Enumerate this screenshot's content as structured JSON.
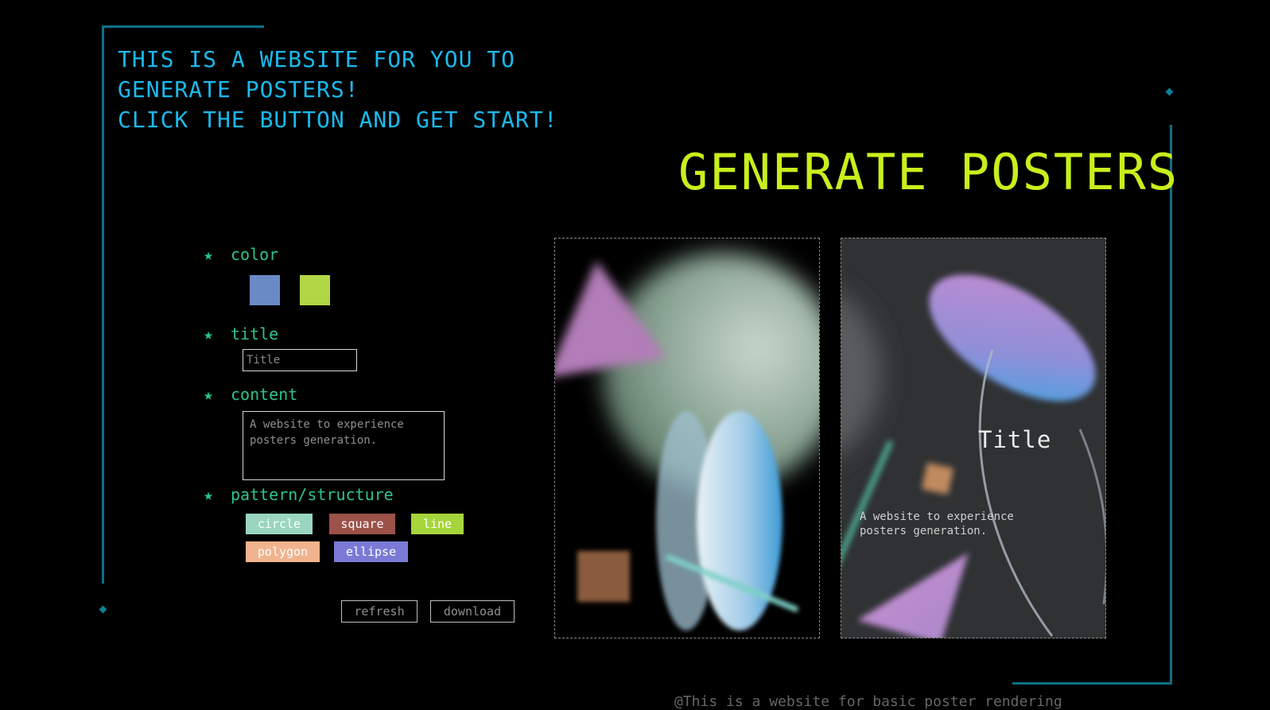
{
  "intro": {
    "lines": [
      "THIS IS A WEBSITE FOR YOU TO",
      "GENERATE POSTERS!",
      "CLICK THE BUTTON AND GET START!"
    ]
  },
  "heading": "GENERATE POSTERS",
  "form": {
    "color_label": "color",
    "colors": [
      "#6a8ac6",
      "#b2d646"
    ],
    "title_label": "title",
    "title_placeholder": "Title",
    "content_label": "content",
    "content_placeholder": "A website to experience posters generation.",
    "pattern_label": "pattern/structure",
    "patterns": [
      {
        "label": "circle",
        "color": "#9ad6bf"
      },
      {
        "label": "square",
        "color": "#9c5149"
      },
      {
        "label": "line",
        "color": "#a5d53b"
      },
      {
        "label": "polygon",
        "color": "#f0b38d"
      },
      {
        "label": "ellipse",
        "color": "#7a7ad6"
      }
    ],
    "refresh_label": "refresh",
    "download_label": "download"
  },
  "poster_preview": {
    "title": "Title",
    "content": "A website to experience posters generation."
  },
  "footer": "@This is a website for basic poster rendering"
}
